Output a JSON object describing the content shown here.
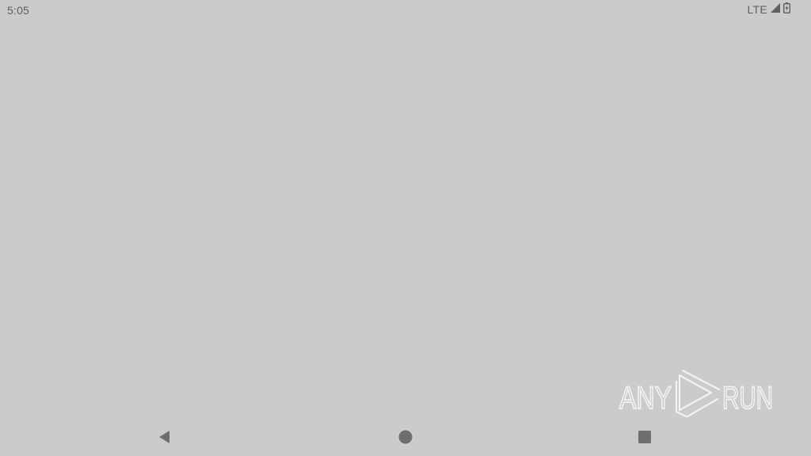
{
  "status_bar": {
    "time": "5:05",
    "network": "LTE",
    "signal_icon": "signal-icon",
    "battery_icon": "battery-charging-icon"
  },
  "watermark": {
    "left_text": "ANY",
    "right_text": "RUN",
    "icon": "play-logo-icon"
  },
  "nav_bar": {
    "back_icon": "back-triangle-icon",
    "home_icon": "home-circle-icon",
    "recents_icon": "recents-square-icon"
  },
  "colors": {
    "background": "#cbcbcb",
    "status_text": "#5f5f5f",
    "nav_icon": "#6e6e6e",
    "watermark": "#f2f2f2"
  }
}
